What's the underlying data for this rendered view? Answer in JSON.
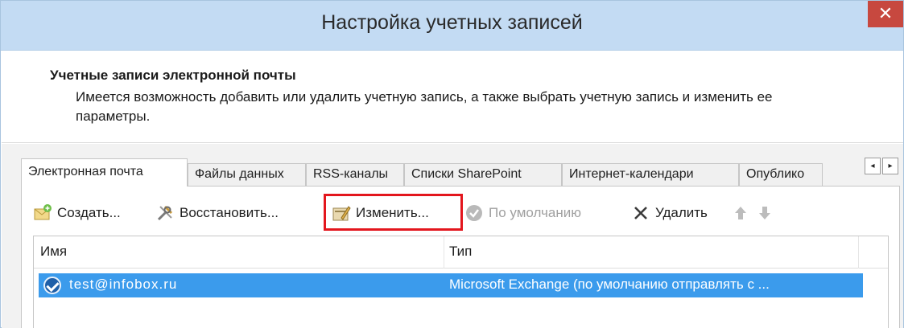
{
  "window": {
    "title": "Настройка учетных записей",
    "close": "✕"
  },
  "header": {
    "title": "Учетные записи электронной почты",
    "description": "Имеется возможность добавить или удалить учетную запись, а также выбрать учетную запись и изменить ее параметры."
  },
  "tabs": [
    {
      "label": "Электронная почта",
      "active": true
    },
    {
      "label": "Файлы данных",
      "active": false
    },
    {
      "label": "RSS-каналы",
      "active": false
    },
    {
      "label": "Списки SharePoint",
      "active": false
    },
    {
      "label": "Интернет-календари",
      "active": false
    },
    {
      "label": "Опублико",
      "active": false
    }
  ],
  "tab_scroll": {
    "left": "◂",
    "right": "▸"
  },
  "toolbar": {
    "create": "Создать...",
    "repair": "Восстановить...",
    "change": "Изменить...",
    "set_default": "По умолчанию",
    "delete": "Удалить"
  },
  "list": {
    "columns": [
      "Имя",
      "Тип"
    ],
    "rows": [
      {
        "name": "test@infobox.ru",
        "type": "Microsoft Exchange (по умолчанию отправлять с ...",
        "selected": true
      }
    ]
  },
  "colors": {
    "titlebar": "#c3dbf3",
    "close": "#c7483f",
    "selection": "#3b9bec",
    "highlight_border": "#e3161d"
  }
}
